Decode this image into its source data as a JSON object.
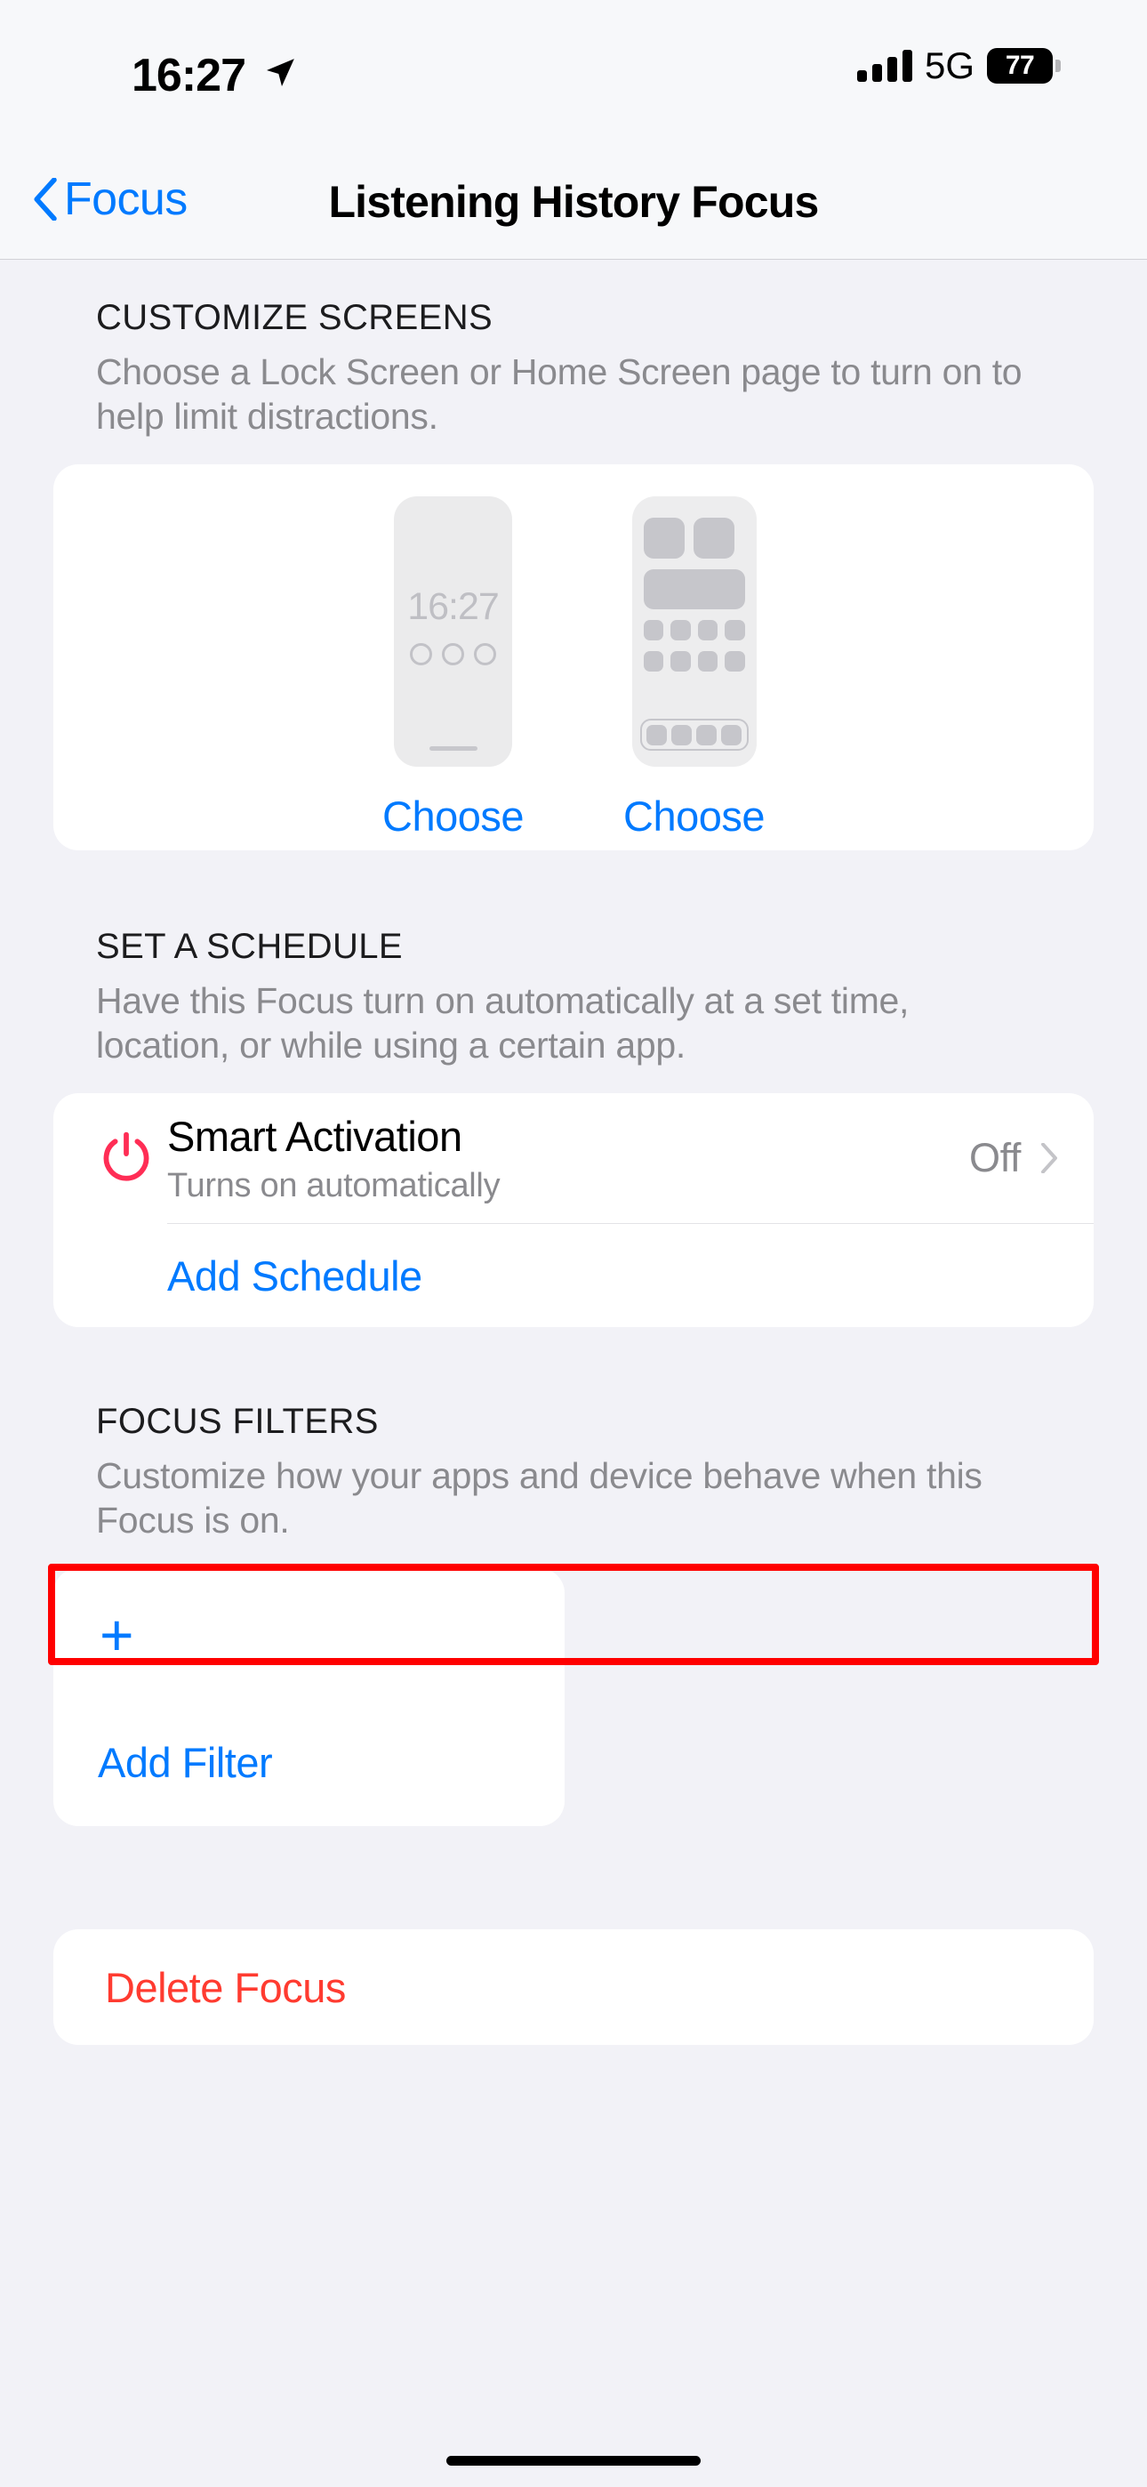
{
  "status_bar": {
    "time": "16:27",
    "location_icon": "location-arrow-icon",
    "signal_icon": "cellular-signal-icon",
    "network": "5G",
    "battery_level": "77"
  },
  "nav": {
    "back_label": "Focus",
    "back_icon": "chevron-left-icon",
    "title": "Listening History Focus"
  },
  "customize_screens": {
    "header": "CUSTOMIZE SCREENS",
    "subtitle": "Choose a Lock Screen or Home Screen page to turn on to help limit distractions.",
    "lock_preview": {
      "time": "16:27",
      "widget_dots": 3
    },
    "home_preview": {
      "top_widgets": 2,
      "wide_widgets": 1,
      "app_rows": 2,
      "apps_per_row": 4,
      "dock_apps": 4
    },
    "lock_choose_label": "Choose",
    "home_choose_label": "Choose"
  },
  "set_a_schedule": {
    "header": "SET A SCHEDULE",
    "subtitle": "Have this Focus turn on automatically at a set time, location, or while using a certain app.",
    "smart_activation": {
      "icon": "power-icon",
      "icon_color": "#FF2D55",
      "title": "Smart Activation",
      "subtitle": "Turns on automatically",
      "value": "Off",
      "chevron_icon": "chevron-right-icon"
    },
    "add_schedule_label": "Add Schedule",
    "highlight_color": "#FF0000"
  },
  "focus_filters": {
    "header": "FOCUS FILTERS",
    "subtitle": "Customize how your apps and device behave when this Focus is on.",
    "add_icon": "plus-icon",
    "add_label": "Add Filter"
  },
  "delete": {
    "label": "Delete Focus",
    "color": "#FF3B30"
  },
  "accent_color": "#007AFF"
}
